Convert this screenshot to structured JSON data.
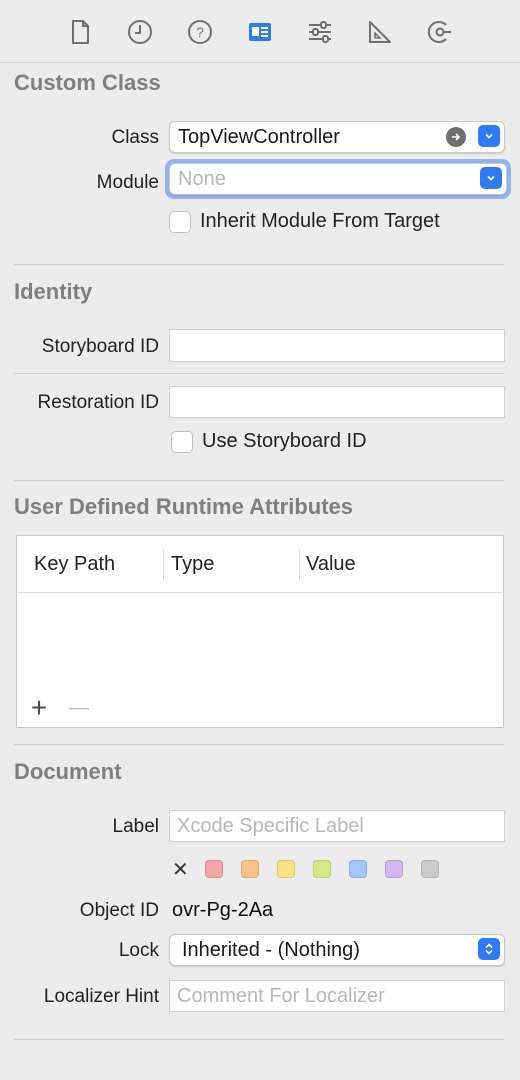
{
  "toolbar": {
    "tabs": [
      {
        "name": "file-inspector"
      },
      {
        "name": "history-inspector"
      },
      {
        "name": "help-inspector"
      },
      {
        "name": "identity-inspector"
      },
      {
        "name": "attributes-inspector"
      },
      {
        "name": "size-inspector"
      },
      {
        "name": "connections-inspector"
      }
    ],
    "active_color": "#2f7bf6"
  },
  "custom_class": {
    "title": "Custom Class",
    "class_label": "Class",
    "class_value": "TopViewController",
    "module_label": "Module",
    "module_placeholder": "None",
    "inherit_label": "Inherit Module From Target",
    "inherit_checked": false
  },
  "identity": {
    "title": "Identity",
    "storyboard_id_label": "Storyboard ID",
    "storyboard_id_value": "",
    "restoration_id_label": "Restoration ID",
    "restoration_id_value": "",
    "use_storyboard_label": "Use Storyboard ID",
    "use_storyboard_checked": false
  },
  "runtime_attributes": {
    "title": "User Defined Runtime Attributes",
    "columns": [
      "Key Path",
      "Type",
      "Value"
    ],
    "rows": [],
    "add_label": "+",
    "remove_label": "—"
  },
  "document": {
    "title": "Document",
    "label_label": "Label",
    "label_placeholder": "Xcode Specific Label",
    "clear_label": "✕",
    "label_colors": [
      "#f4a6a3",
      "#f5c38a",
      "#f6e27f",
      "#d2e889",
      "#a3c8f6",
      "#d5b6ee",
      "#cbcbcb"
    ],
    "object_id_label": "Object ID",
    "object_id_value": "ovr-Pg-2Aa",
    "lock_label": "Lock",
    "lock_value": "Inherited - (Nothing)",
    "localizer_label": "Localizer Hint",
    "localizer_placeholder": "Comment For Localizer"
  }
}
